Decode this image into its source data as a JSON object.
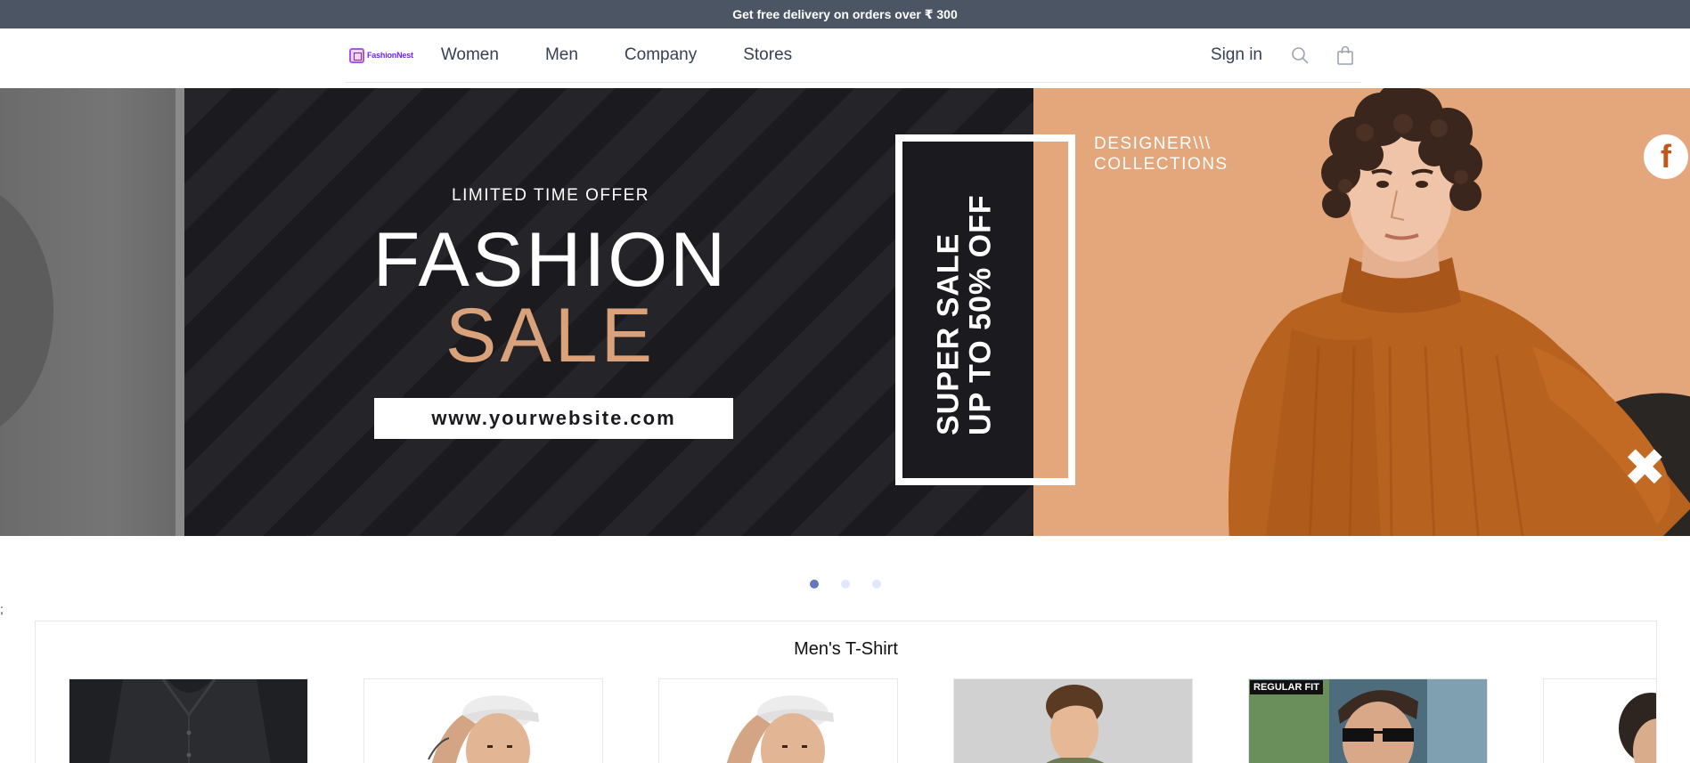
{
  "promo": {
    "text": "Get free delivery on orders over ₹ 300"
  },
  "nav": {
    "logo_text": "FashionNest",
    "links": [
      "Women",
      "Men",
      "Company",
      "Stores"
    ],
    "signin": "Sign in",
    "icons": [
      "search-icon",
      "shopping-bag-icon"
    ]
  },
  "hero": {
    "limited": "LIMITED TIME OFFER",
    "title_line1": "FASHION",
    "title_line2": "SALE",
    "url": "www.yourwebsite.com",
    "vertical_line1": "SUPER SALE",
    "vertical_line2": "UP TO 50% OFF",
    "designer_line1": "DESIGNER\\\\\\",
    "designer_line2": "COLLECTIONS",
    "fb_letter": "f",
    "x_glyph": "✖",
    "colors": {
      "dark": "#1b1a1f",
      "peach": "#e3a77b",
      "gold": "#d9a27a"
    }
  },
  "carousel": {
    "slides": 3,
    "active_index": 0
  },
  "stray_text": ";",
  "section": {
    "title": "Men's T-Shirt",
    "badge": "REGULAR FIT"
  }
}
